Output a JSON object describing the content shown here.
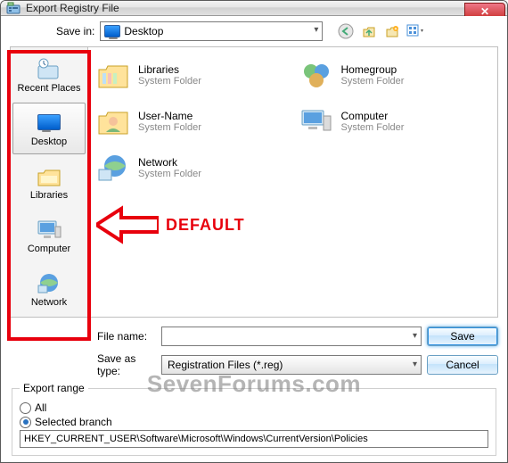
{
  "window": {
    "title": "Export Registry File",
    "close_glyph": "✕"
  },
  "save_in": {
    "label": "Save in:",
    "value": "Desktop"
  },
  "toolbar_icons": {
    "back": "back-arrow",
    "up": "up-one-level",
    "new_folder": "new-folder",
    "views": "views-menu"
  },
  "places": [
    {
      "key": "recent",
      "label": "Recent Places",
      "selected": false
    },
    {
      "key": "desktop",
      "label": "Desktop",
      "selected": true
    },
    {
      "key": "libraries",
      "label": "Libraries",
      "selected": false
    },
    {
      "key": "computer",
      "label": "Computer",
      "selected": false
    },
    {
      "key": "network",
      "label": "Network",
      "selected": false
    }
  ],
  "items": [
    {
      "name": "Libraries",
      "sub": "System Folder"
    },
    {
      "name": "Homegroup",
      "sub": "System Folder"
    },
    {
      "name": "User-Name",
      "sub": "System Folder"
    },
    {
      "name": "Computer",
      "sub": "System Folder"
    },
    {
      "name": "Network",
      "sub": "System Folder"
    }
  ],
  "file_name": {
    "label": "File name:",
    "value": ""
  },
  "save_as_type": {
    "label": "Save as type:",
    "value": "Registration Files (*.reg)"
  },
  "buttons": {
    "save": "Save",
    "cancel": "Cancel"
  },
  "export_range": {
    "legend": "Export range",
    "option_all": "All",
    "option_selected": "Selected branch",
    "selected": "selected",
    "path": "HKEY_CURRENT_USER\\Software\\Microsoft\\Windows\\CurrentVersion\\Policies"
  },
  "annotation": {
    "arrow_label": "DEFAULT",
    "watermark": "SevenForums.com"
  }
}
